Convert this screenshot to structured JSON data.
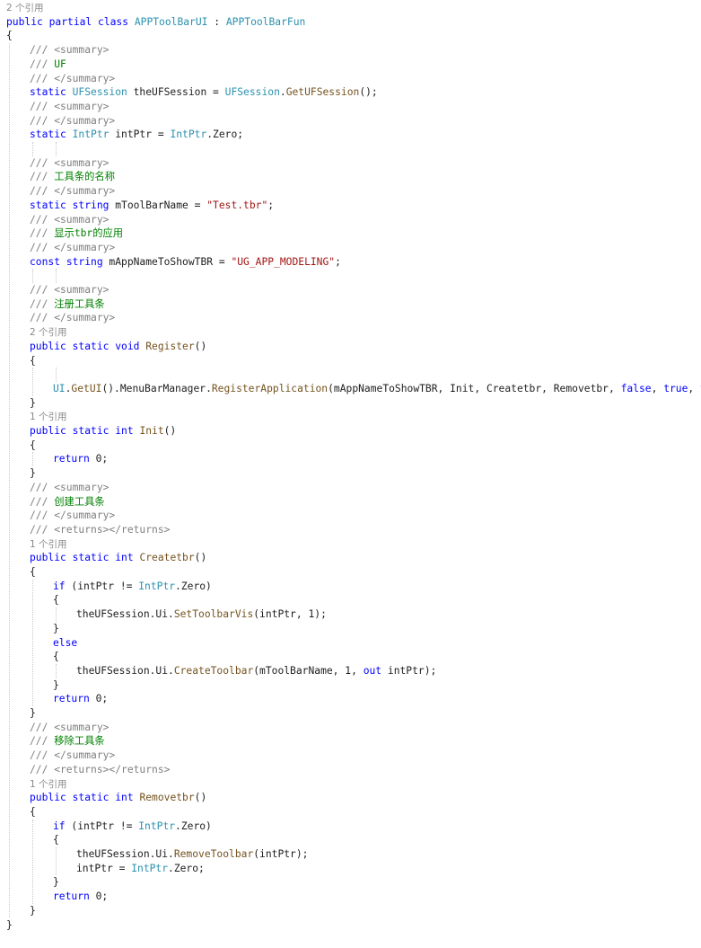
{
  "code": {
    "lines": [
      {
        "indent": 0,
        "tokens": [
          {
            "t": "2 个引用",
            "c": "lens"
          }
        ]
      },
      {
        "indent": 0,
        "tokens": [
          {
            "t": "public ",
            "c": "kw"
          },
          {
            "t": "partial ",
            "c": "kw"
          },
          {
            "t": "class ",
            "c": "kw"
          },
          {
            "t": "APPToolBarUI",
            "c": "ty"
          },
          {
            "t": " : ",
            "c": "plain"
          },
          {
            "t": "APPToolBarFun",
            "c": "ty"
          }
        ]
      },
      {
        "indent": 0,
        "tokens": [
          {
            "t": "{",
            "c": "plain"
          }
        ]
      },
      {
        "indent": 1,
        "tokens": [
          {
            "t": "/// <summary>",
            "c": "doc"
          }
        ]
      },
      {
        "indent": 1,
        "tokens": [
          {
            "t": "/// ",
            "c": "doc"
          },
          {
            "t": "UF",
            "c": "cm"
          }
        ]
      },
      {
        "indent": 1,
        "tokens": [
          {
            "t": "/// </summary>",
            "c": "doc"
          }
        ]
      },
      {
        "indent": 1,
        "tokens": [
          {
            "t": "static ",
            "c": "kw"
          },
          {
            "t": "UFSession",
            "c": "ty"
          },
          {
            "t": " theUFSession = ",
            "c": "plain"
          },
          {
            "t": "UFSession",
            "c": "ty"
          },
          {
            "t": ".",
            "c": "plain"
          },
          {
            "t": "GetUFSession",
            "c": "fn"
          },
          {
            "t": "();",
            "c": "plain"
          }
        ]
      },
      {
        "indent": 1,
        "tokens": [
          {
            "t": "/// <summary>",
            "c": "doc"
          }
        ]
      },
      {
        "indent": 1,
        "tokens": [
          {
            "t": "/// </summary>",
            "c": "doc"
          }
        ]
      },
      {
        "indent": 1,
        "tokens": [
          {
            "t": "static ",
            "c": "kw"
          },
          {
            "t": "IntPtr",
            "c": "ty"
          },
          {
            "t": " intPtr = ",
            "c": "plain"
          },
          {
            "t": "IntPtr",
            "c": "ty"
          },
          {
            "t": ".Zero;",
            "c": "plain"
          }
        ]
      },
      {
        "indent": 0,
        "tokens": []
      },
      {
        "indent": 1,
        "tokens": [
          {
            "t": "/// <summary>",
            "c": "doc"
          }
        ]
      },
      {
        "indent": 1,
        "tokens": [
          {
            "t": "/// ",
            "c": "doc"
          },
          {
            "t": "工具条的名称",
            "c": "cm"
          }
        ]
      },
      {
        "indent": 1,
        "tokens": [
          {
            "t": "/// </summary>",
            "c": "doc"
          }
        ]
      },
      {
        "indent": 1,
        "tokens": [
          {
            "t": "static ",
            "c": "kw"
          },
          {
            "t": "string ",
            "c": "kw"
          },
          {
            "t": "mToolBarName = ",
            "c": "plain"
          },
          {
            "t": "\"Test.tbr\"",
            "c": "str"
          },
          {
            "t": ";",
            "c": "plain"
          }
        ]
      },
      {
        "indent": 1,
        "tokens": [
          {
            "t": "/// <summary>",
            "c": "doc"
          }
        ]
      },
      {
        "indent": 1,
        "tokens": [
          {
            "t": "/// ",
            "c": "doc"
          },
          {
            "t": "显示tbr的应用",
            "c": "cm"
          }
        ]
      },
      {
        "indent": 1,
        "tokens": [
          {
            "t": "/// </summary>",
            "c": "doc"
          }
        ]
      },
      {
        "indent": 1,
        "tokens": [
          {
            "t": "const ",
            "c": "kw"
          },
          {
            "t": "string ",
            "c": "kw"
          },
          {
            "t": "mAppNameToShowTBR = ",
            "c": "plain"
          },
          {
            "t": "\"UG_APP_MODELING\"",
            "c": "str"
          },
          {
            "t": ";",
            "c": "plain"
          }
        ]
      },
      {
        "indent": 0,
        "tokens": []
      },
      {
        "indent": 1,
        "tokens": [
          {
            "t": "/// <summary>",
            "c": "doc"
          }
        ]
      },
      {
        "indent": 1,
        "tokens": [
          {
            "t": "/// ",
            "c": "doc"
          },
          {
            "t": "注册工具条",
            "c": "cm"
          }
        ]
      },
      {
        "indent": 1,
        "tokens": [
          {
            "t": "/// </summary>",
            "c": "doc"
          }
        ]
      },
      {
        "indent": 1,
        "tokens": [
          {
            "t": "2 个引用",
            "c": "lens"
          }
        ]
      },
      {
        "indent": 1,
        "tokens": [
          {
            "t": "public ",
            "c": "kw"
          },
          {
            "t": "static ",
            "c": "kw"
          },
          {
            "t": "void ",
            "c": "kw"
          },
          {
            "t": "Register",
            "c": "fn"
          },
          {
            "t": "()",
            "c": "plain"
          }
        ]
      },
      {
        "indent": 1,
        "tokens": [
          {
            "t": "{",
            "c": "plain"
          }
        ]
      },
      {
        "indent": 0,
        "tokens": []
      },
      {
        "indent": 2,
        "tokens": [
          {
            "t": "UI",
            "c": "ty"
          },
          {
            "t": ".",
            "c": "plain"
          },
          {
            "t": "GetUI",
            "c": "fn"
          },
          {
            "t": "().",
            "c": "plain"
          },
          {
            "t": "MenuBarManager",
            "c": "plain"
          },
          {
            "t": ".",
            "c": "plain"
          },
          {
            "t": "RegisterApplication",
            "c": "fn"
          },
          {
            "t": "(mAppNameToShowTBR, Init, Createtbr, Removetbr, ",
            "c": "plain"
          },
          {
            "t": "false",
            "c": "kw"
          },
          {
            "t": ", ",
            "c": "plain"
          },
          {
            "t": "true",
            "c": "kw"
          },
          {
            "t": ", ",
            "c": "plain"
          },
          {
            "t": "true",
            "c": "kw"
          },
          {
            "t": ");",
            "c": "plain"
          }
        ]
      },
      {
        "indent": 1,
        "tokens": [
          {
            "t": "}",
            "c": "plain"
          }
        ]
      },
      {
        "indent": 1,
        "tokens": [
          {
            "t": "1 个引用",
            "c": "lens"
          }
        ]
      },
      {
        "indent": 1,
        "tokens": [
          {
            "t": "public ",
            "c": "kw"
          },
          {
            "t": "static ",
            "c": "kw"
          },
          {
            "t": "int ",
            "c": "kw"
          },
          {
            "t": "Init",
            "c": "fn"
          },
          {
            "t": "()",
            "c": "plain"
          }
        ]
      },
      {
        "indent": 1,
        "tokens": [
          {
            "t": "{",
            "c": "plain"
          }
        ]
      },
      {
        "indent": 2,
        "tokens": [
          {
            "t": "return ",
            "c": "kw"
          },
          {
            "t": "0;",
            "c": "plain"
          }
        ]
      },
      {
        "indent": 1,
        "tokens": [
          {
            "t": "}",
            "c": "plain"
          }
        ]
      },
      {
        "indent": 1,
        "tokens": [
          {
            "t": "/// <summary>",
            "c": "doc"
          }
        ]
      },
      {
        "indent": 1,
        "tokens": [
          {
            "t": "/// ",
            "c": "doc"
          },
          {
            "t": "创建工具条",
            "c": "cm"
          }
        ]
      },
      {
        "indent": 1,
        "tokens": [
          {
            "t": "/// </summary>",
            "c": "doc"
          }
        ]
      },
      {
        "indent": 1,
        "tokens": [
          {
            "t": "/// <returns></returns>",
            "c": "doc"
          }
        ]
      },
      {
        "indent": 1,
        "tokens": [
          {
            "t": "1 个引用",
            "c": "lens"
          }
        ]
      },
      {
        "indent": 1,
        "tokens": [
          {
            "t": "public ",
            "c": "kw"
          },
          {
            "t": "static ",
            "c": "kw"
          },
          {
            "t": "int ",
            "c": "kw"
          },
          {
            "t": "Createtbr",
            "c": "fn"
          },
          {
            "t": "()",
            "c": "plain"
          }
        ]
      },
      {
        "indent": 1,
        "tokens": [
          {
            "t": "{",
            "c": "plain"
          }
        ]
      },
      {
        "indent": 2,
        "tokens": [
          {
            "t": "if ",
            "c": "kw"
          },
          {
            "t": "(intPtr != ",
            "c": "plain"
          },
          {
            "t": "IntPtr",
            "c": "ty"
          },
          {
            "t": ".Zero)",
            "c": "plain"
          }
        ]
      },
      {
        "indent": 2,
        "tokens": [
          {
            "t": "{",
            "c": "plain"
          }
        ]
      },
      {
        "indent": 3,
        "tokens": [
          {
            "t": "theUFSession.Ui.",
            "c": "plain"
          },
          {
            "t": "SetToolbarVis",
            "c": "fn"
          },
          {
            "t": "(intPtr, 1);",
            "c": "plain"
          }
        ]
      },
      {
        "indent": 2,
        "tokens": [
          {
            "t": "}",
            "c": "plain"
          }
        ]
      },
      {
        "indent": 2,
        "tokens": [
          {
            "t": "else",
            "c": "kw"
          }
        ]
      },
      {
        "indent": 2,
        "tokens": [
          {
            "t": "{",
            "c": "plain"
          }
        ]
      },
      {
        "indent": 3,
        "tokens": [
          {
            "t": "theUFSession.Ui.",
            "c": "plain"
          },
          {
            "t": "CreateToolbar",
            "c": "fn"
          },
          {
            "t": "(mToolBarName, 1, ",
            "c": "plain"
          },
          {
            "t": "out ",
            "c": "kw"
          },
          {
            "t": "intPtr);",
            "c": "plain"
          }
        ]
      },
      {
        "indent": 2,
        "tokens": [
          {
            "t": "}",
            "c": "plain"
          }
        ]
      },
      {
        "indent": 2,
        "tokens": [
          {
            "t": "return ",
            "c": "kw"
          },
          {
            "t": "0;",
            "c": "plain"
          }
        ]
      },
      {
        "indent": 1,
        "tokens": [
          {
            "t": "}",
            "c": "plain"
          }
        ]
      },
      {
        "indent": 1,
        "tokens": [
          {
            "t": "/// <summary>",
            "c": "doc"
          }
        ]
      },
      {
        "indent": 1,
        "tokens": [
          {
            "t": "/// ",
            "c": "doc"
          },
          {
            "t": "移除工具条",
            "c": "cm"
          }
        ]
      },
      {
        "indent": 1,
        "tokens": [
          {
            "t": "/// </summary>",
            "c": "doc"
          }
        ]
      },
      {
        "indent": 1,
        "tokens": [
          {
            "t": "/// <returns></returns>",
            "c": "doc"
          }
        ]
      },
      {
        "indent": 1,
        "tokens": [
          {
            "t": "1 个引用",
            "c": "lens"
          }
        ]
      },
      {
        "indent": 1,
        "tokens": [
          {
            "t": "public ",
            "c": "kw"
          },
          {
            "t": "static ",
            "c": "kw"
          },
          {
            "t": "int ",
            "c": "kw"
          },
          {
            "t": "Removetbr",
            "c": "fn"
          },
          {
            "t": "()",
            "c": "plain"
          }
        ]
      },
      {
        "indent": 1,
        "tokens": [
          {
            "t": "{",
            "c": "plain"
          }
        ]
      },
      {
        "indent": 2,
        "tokens": [
          {
            "t": "if ",
            "c": "kw"
          },
          {
            "t": "(intPtr != ",
            "c": "plain"
          },
          {
            "t": "IntPtr",
            "c": "ty"
          },
          {
            "t": ".Zero)",
            "c": "plain"
          }
        ]
      },
      {
        "indent": 2,
        "tokens": [
          {
            "t": "{",
            "c": "plain"
          }
        ]
      },
      {
        "indent": 3,
        "tokens": [
          {
            "t": "theUFSession.Ui.",
            "c": "plain"
          },
          {
            "t": "RemoveToolbar",
            "c": "fn"
          },
          {
            "t": "(intPtr);",
            "c": "plain"
          }
        ]
      },
      {
        "indent": 3,
        "tokens": [
          {
            "t": "intPtr = ",
            "c": "plain"
          },
          {
            "t": "IntPtr",
            "c": "ty"
          },
          {
            "t": ".Zero;",
            "c": "plain"
          }
        ]
      },
      {
        "indent": 2,
        "tokens": [
          {
            "t": "}",
            "c": "plain"
          }
        ]
      },
      {
        "indent": 2,
        "tokens": [
          {
            "t": "return ",
            "c": "kw"
          },
          {
            "t": "0;",
            "c": "plain"
          }
        ]
      },
      {
        "indent": 1,
        "tokens": [
          {
            "t": "}",
            "c": "plain"
          }
        ]
      },
      {
        "indent": 0,
        "tokens": [
          {
            "t": "}",
            "c": "plain"
          }
        ]
      }
    ]
  },
  "colors": {
    "keyword": "#0000ff",
    "type": "#2b91af",
    "method": "#74531f",
    "string": "#a31515",
    "comment": "#008000",
    "doc_tag": "#808080",
    "codelens": "#8a8a8a",
    "background": "#ffffff"
  }
}
